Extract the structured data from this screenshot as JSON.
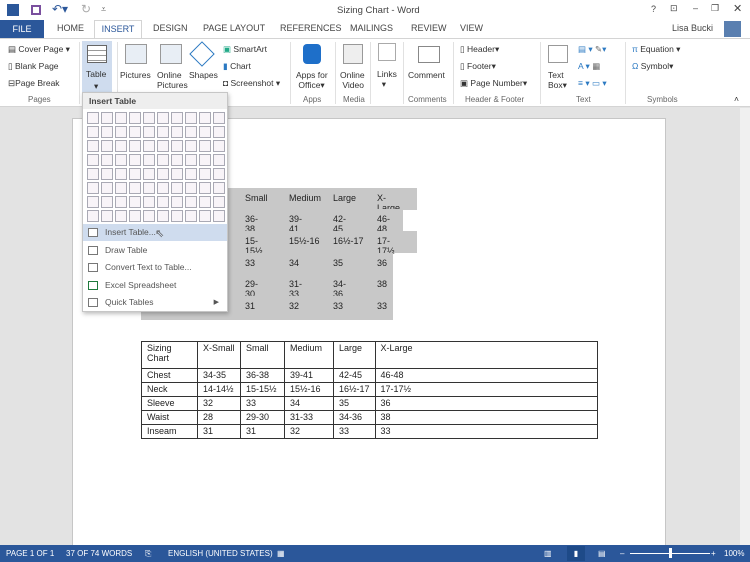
{
  "window": {
    "title": "Sizing Chart - Word",
    "user": "Lisa Bucki"
  },
  "tabs": [
    "FILE",
    "HOME",
    "INSERT",
    "DESIGN",
    "PAGE LAYOUT",
    "REFERENCES",
    "MAILINGS",
    "REVIEW",
    "VIEW"
  ],
  "ribbon": {
    "pages": {
      "cover": "Cover Page",
      "blank": "Blank Page",
      "break": "Page Break",
      "label": "Pages"
    },
    "table": {
      "label": "Table"
    },
    "illustrations": {
      "pictures": "Pictures",
      "online1": "Online",
      "online2": "Pictures",
      "shapes": "Shapes",
      "smartart": "SmartArt",
      "chart": "Chart",
      "screenshot": "Screenshot"
    },
    "apps": {
      "l1": "Apps for",
      "l2": "Office",
      "label": "Apps"
    },
    "media": {
      "l1": "Online",
      "l2": "Video",
      "label": "Media"
    },
    "links": {
      "label": "Links"
    },
    "comments": {
      "comment": "Comment",
      "label": "Comments"
    },
    "hf": {
      "header": "Header",
      "footer": "Footer",
      "pagenum": "Page Number",
      "label": "Header & Footer"
    },
    "text": {
      "l1": "Text",
      "l2": "Box",
      "label": "Text"
    },
    "symbols": {
      "equation": "Equation",
      "symbol": "Symbol",
      "label": "Symbols"
    }
  },
  "dropdown": {
    "title": "Insert Table",
    "grid_cols": 10,
    "grid_rows": 8,
    "items": [
      "Insert Table...",
      "Draw Table",
      "Convert Text to Table...",
      "Excel Spreadsheet",
      "Quick Tables"
    ]
  },
  "selected_table": [
    [
      "all",
      "Small",
      "Medium",
      "Large",
      "X-Large"
    ],
    [
      "",
      "36-38",
      "39-41",
      "42-45",
      "46-48"
    ],
    [
      "½",
      "15-15½",
      "15½-16",
      "16½-17",
      "17-17½"
    ],
    [
      "",
      "33",
      "34",
      "35",
      "36"
    ],
    [
      "",
      "29-30",
      "31-33",
      "34-36",
      "38"
    ],
    [
      "",
      "31",
      "32",
      "33",
      "33"
    ]
  ],
  "table": [
    [
      "Sizing Chart",
      "X-Small",
      "Small",
      "Medium",
      "Large",
      "X-Large"
    ],
    [
      "Chest",
      "34-35",
      "36-38",
      "39-41",
      "42-45",
      "46-48"
    ],
    [
      "Neck",
      "14-14½",
      "15-15½",
      "15½-16",
      "16½-17",
      "17-17½"
    ],
    [
      "Sleeve",
      "32",
      "33",
      "34",
      "35",
      "36"
    ],
    [
      "Waist",
      "28",
      "29-30",
      "31-33",
      "34-36",
      "38"
    ],
    [
      "Inseam",
      "31",
      "31",
      "32",
      "33",
      "33"
    ]
  ],
  "status": {
    "page": "PAGE 1 OF 1",
    "words": "37 OF 74 WORDS",
    "lang": "ENGLISH (UNITED STATES)",
    "zoom": "100%",
    "zoom_percent": 100
  },
  "colors": {
    "accent": "#2b579a"
  }
}
